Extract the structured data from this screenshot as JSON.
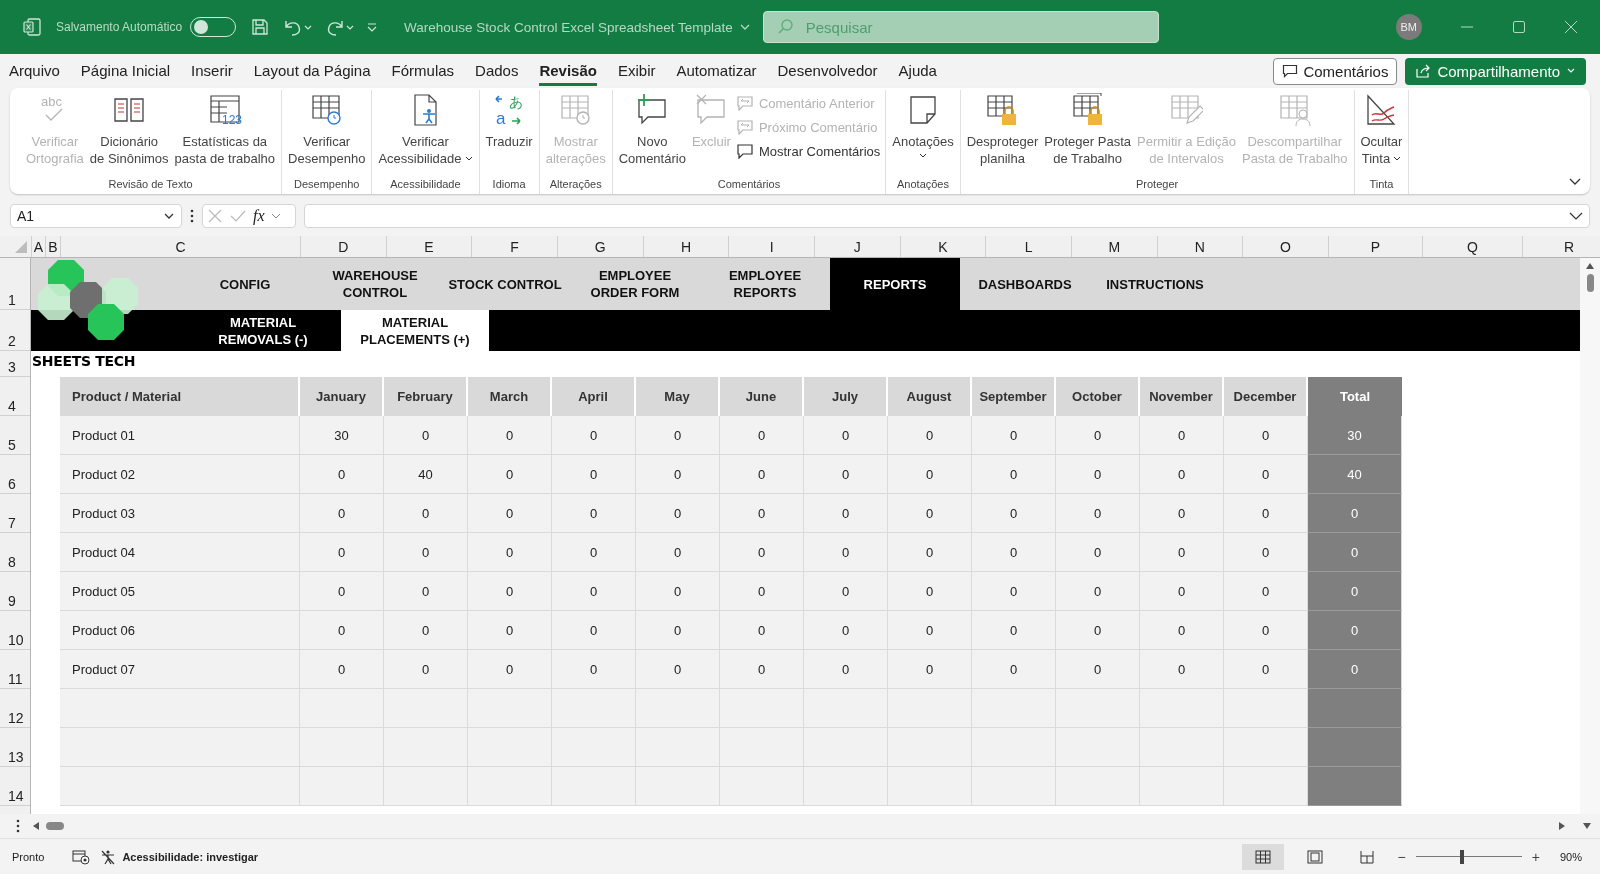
{
  "window": {
    "autosave_label": "Salvamento Automático",
    "autosave_on": false,
    "title": "Warehouse Stock Control Excel Spreadsheet Template",
    "search_placeholder": "Pesquisar",
    "user_initials": "BM"
  },
  "menu_tabs": [
    {
      "label": "Arquivo",
      "selected": false
    },
    {
      "label": "Página Inicial",
      "selected": false
    },
    {
      "label": "Inserir",
      "selected": false
    },
    {
      "label": "Layout da Página",
      "selected": false
    },
    {
      "label": "Fórmulas",
      "selected": false
    },
    {
      "label": "Dados",
      "selected": false
    },
    {
      "label": "Revisão",
      "selected": true
    },
    {
      "label": "Exibir",
      "selected": false
    },
    {
      "label": "Automatizar",
      "selected": false
    },
    {
      "label": "Desenvolvedor",
      "selected": false
    },
    {
      "label": "Ajuda",
      "selected": false
    }
  ],
  "header_buttons": {
    "comments": "Comentários",
    "share": "Compartilhamento"
  },
  "ribbon_groups": [
    {
      "label": "Revisão de Texto",
      "items": [
        {
          "kind": "large",
          "lines": [
            "Verificar",
            "Ortografia"
          ],
          "disabled": true,
          "icon_text": "abc"
        },
        {
          "kind": "large",
          "lines": [
            "Dicionário",
            "de Sinônimos"
          ],
          "disabled": false
        },
        {
          "kind": "large",
          "lines": [
            "Estatísticas da",
            "pasta de trabalho"
          ],
          "disabled": false,
          "icon_text": "123"
        }
      ]
    },
    {
      "label": "Desempenho",
      "items": [
        {
          "kind": "large",
          "lines": [
            "Verificar",
            "Desempenho"
          ],
          "disabled": false
        }
      ]
    },
    {
      "label": "Acessibilidade",
      "items": [
        {
          "kind": "large",
          "lines": [
            "Verificar",
            "Acessibilidade"
          ],
          "disabled": false,
          "dropdown": true
        }
      ]
    },
    {
      "label": "Idioma",
      "items": [
        {
          "kind": "large",
          "lines": [
            "Traduzir"
          ],
          "disabled": false,
          "icon_text": "あ",
          "icon_text_2": "a"
        }
      ]
    },
    {
      "label": "Alterações",
      "items": [
        {
          "kind": "large",
          "lines": [
            "Mostrar",
            "alterações"
          ],
          "disabled": true
        }
      ]
    },
    {
      "label": "Comentários",
      "items": [
        {
          "kind": "large",
          "lines": [
            "Novo",
            "Comentário"
          ],
          "disabled": false
        },
        {
          "kind": "large",
          "lines": [
            "Excluir"
          ],
          "disabled": true
        },
        {
          "kind": "small",
          "lines": [
            "Comentário Anterior"
          ],
          "disabled": true
        },
        {
          "kind": "small",
          "lines": [
            "Próximo Comentário"
          ],
          "disabled": true
        },
        {
          "kind": "small",
          "lines": [
            "Mostrar Comentários"
          ],
          "disabled": false
        }
      ]
    },
    {
      "label": "Anotações",
      "items": [
        {
          "kind": "large",
          "lines": [
            "Anotações"
          ],
          "disabled": false,
          "dropdown": true
        }
      ]
    },
    {
      "label": "Proteger",
      "items": [
        {
          "kind": "large",
          "lines": [
            "Desproteger",
            "planilha"
          ],
          "disabled": false
        },
        {
          "kind": "large",
          "lines": [
            "Proteger Pasta",
            "de Trabalho"
          ],
          "disabled": false
        },
        {
          "kind": "large",
          "lines": [
            "Permitir a Edição",
            "de Intervalos"
          ],
          "disabled": true
        },
        {
          "kind": "large",
          "lines": [
            "Descompartilhar",
            "Pasta de Trabalho"
          ],
          "disabled": true
        }
      ]
    },
    {
      "label": "Tinta",
      "items": [
        {
          "kind": "large",
          "lines": [
            "Ocultar",
            "Tinta"
          ],
          "disabled": false,
          "dropdown": true
        }
      ]
    }
  ],
  "formula_bar": {
    "name_box": "A1",
    "fx": "fx"
  },
  "column_letters": [
    "A",
    "B",
    "C",
    "D",
    "E",
    "F",
    "G",
    "H",
    "I",
    "J",
    "K",
    "L",
    "M",
    "N",
    "O",
    "P",
    "Q",
    "R"
  ],
  "row_numbers": [
    "1",
    "2",
    "3",
    "4",
    "5",
    "6",
    "7",
    "8",
    "9",
    "10",
    "11",
    "12",
    "13",
    "14"
  ],
  "logo": {
    "text": "SHEETS TECH"
  },
  "nav_tabs": [
    {
      "label": "CONFIG",
      "selected": false
    },
    {
      "label": "WAREHOUSE CONTROL",
      "selected": false
    },
    {
      "label": "STOCK CONTROL",
      "selected": false
    },
    {
      "label": "EMPLOYEE ORDER FORM",
      "selected": false
    },
    {
      "label": "EMPLOYEE REPORTS",
      "selected": false
    },
    {
      "label": "REPORTS",
      "selected": true
    },
    {
      "label": "DASHBOARDS",
      "selected": false
    },
    {
      "label": "INSTRUCTIONS",
      "selected": false
    }
  ],
  "sub_tabs": [
    {
      "label": "MATERIAL REMOVALS (-)",
      "selected": false
    },
    {
      "label": "MATERIAL PLACEMENTS (+)",
      "selected": true
    }
  ],
  "table": {
    "columns": [
      "Product / Material",
      "January",
      "February",
      "March",
      "April",
      "May",
      "June",
      "July",
      "August",
      "September",
      "October",
      "November",
      "December",
      "Total"
    ],
    "rows": [
      {
        "product": "Product 01",
        "values": [
          "30",
          "0",
          "0",
          "0",
          "0",
          "0",
          "0",
          "0",
          "0",
          "0",
          "0",
          "0"
        ],
        "total": "30"
      },
      {
        "product": "Product 02",
        "values": [
          "0",
          "40",
          "0",
          "0",
          "0",
          "0",
          "0",
          "0",
          "0",
          "0",
          "0",
          "0"
        ],
        "total": "40"
      },
      {
        "product": "Product 03",
        "values": [
          "0",
          "0",
          "0",
          "0",
          "0",
          "0",
          "0",
          "0",
          "0",
          "0",
          "0",
          "0"
        ],
        "total": "0"
      },
      {
        "product": "Product 04",
        "values": [
          "0",
          "0",
          "0",
          "0",
          "0",
          "0",
          "0",
          "0",
          "0",
          "0",
          "0",
          "0"
        ],
        "total": "0"
      },
      {
        "product": "Product 05",
        "values": [
          "0",
          "0",
          "0",
          "0",
          "0",
          "0",
          "0",
          "0",
          "0",
          "0",
          "0",
          "0"
        ],
        "total": "0"
      },
      {
        "product": "Product 06",
        "values": [
          "0",
          "0",
          "0",
          "0",
          "0",
          "0",
          "0",
          "0",
          "0",
          "0",
          "0",
          "0"
        ],
        "total": "0"
      },
      {
        "product": "Product 07",
        "values": [
          "0",
          "0",
          "0",
          "0",
          "0",
          "0",
          "0",
          "0",
          "0",
          "0",
          "0",
          "0"
        ],
        "total": "0"
      }
    ]
  },
  "status_bar": {
    "status": "Pronto",
    "accessibility": "Acessibilidade: investigar",
    "views": [
      {
        "selected": true
      },
      {
        "selected": false
      },
      {
        "selected": false
      }
    ],
    "zoom_minus": "−",
    "zoom_plus": "+",
    "zoom": {
      "level": 0.44
    },
    "zoom_label": "90%"
  }
}
